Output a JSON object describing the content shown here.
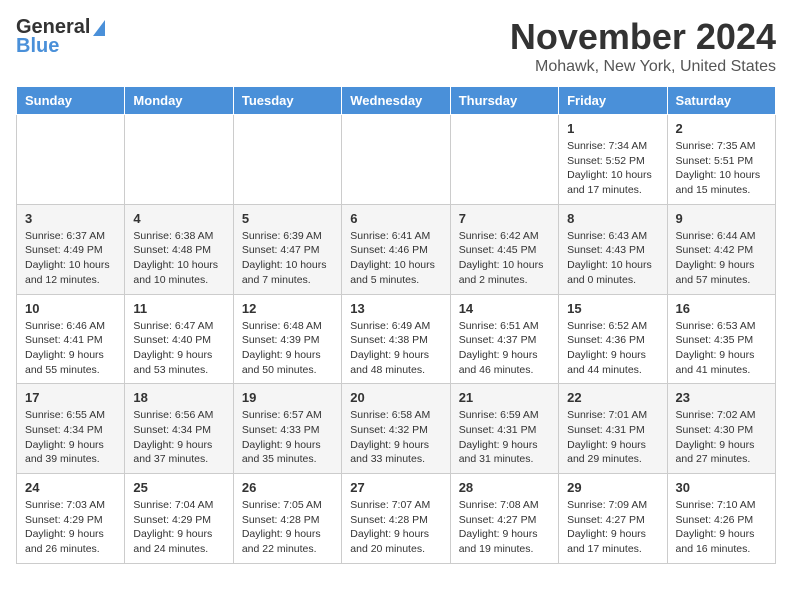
{
  "header": {
    "logo_line1": "General",
    "logo_line2": "Blue",
    "month": "November 2024",
    "location": "Mohawk, New York, United States"
  },
  "weekdays": [
    "Sunday",
    "Monday",
    "Tuesday",
    "Wednesday",
    "Thursday",
    "Friday",
    "Saturday"
  ],
  "weeks": [
    [
      {
        "day": "",
        "info": ""
      },
      {
        "day": "",
        "info": ""
      },
      {
        "day": "",
        "info": ""
      },
      {
        "day": "",
        "info": ""
      },
      {
        "day": "",
        "info": ""
      },
      {
        "day": "1",
        "info": "Sunrise: 7:34 AM\nSunset: 5:52 PM\nDaylight: 10 hours and 17 minutes."
      },
      {
        "day": "2",
        "info": "Sunrise: 7:35 AM\nSunset: 5:51 PM\nDaylight: 10 hours and 15 minutes."
      }
    ],
    [
      {
        "day": "3",
        "info": "Sunrise: 6:37 AM\nSunset: 4:49 PM\nDaylight: 10 hours and 12 minutes."
      },
      {
        "day": "4",
        "info": "Sunrise: 6:38 AM\nSunset: 4:48 PM\nDaylight: 10 hours and 10 minutes."
      },
      {
        "day": "5",
        "info": "Sunrise: 6:39 AM\nSunset: 4:47 PM\nDaylight: 10 hours and 7 minutes."
      },
      {
        "day": "6",
        "info": "Sunrise: 6:41 AM\nSunset: 4:46 PM\nDaylight: 10 hours and 5 minutes."
      },
      {
        "day": "7",
        "info": "Sunrise: 6:42 AM\nSunset: 4:45 PM\nDaylight: 10 hours and 2 minutes."
      },
      {
        "day": "8",
        "info": "Sunrise: 6:43 AM\nSunset: 4:43 PM\nDaylight: 10 hours and 0 minutes."
      },
      {
        "day": "9",
        "info": "Sunrise: 6:44 AM\nSunset: 4:42 PM\nDaylight: 9 hours and 57 minutes."
      }
    ],
    [
      {
        "day": "10",
        "info": "Sunrise: 6:46 AM\nSunset: 4:41 PM\nDaylight: 9 hours and 55 minutes."
      },
      {
        "day": "11",
        "info": "Sunrise: 6:47 AM\nSunset: 4:40 PM\nDaylight: 9 hours and 53 minutes."
      },
      {
        "day": "12",
        "info": "Sunrise: 6:48 AM\nSunset: 4:39 PM\nDaylight: 9 hours and 50 minutes."
      },
      {
        "day": "13",
        "info": "Sunrise: 6:49 AM\nSunset: 4:38 PM\nDaylight: 9 hours and 48 minutes."
      },
      {
        "day": "14",
        "info": "Sunrise: 6:51 AM\nSunset: 4:37 PM\nDaylight: 9 hours and 46 minutes."
      },
      {
        "day": "15",
        "info": "Sunrise: 6:52 AM\nSunset: 4:36 PM\nDaylight: 9 hours and 44 minutes."
      },
      {
        "day": "16",
        "info": "Sunrise: 6:53 AM\nSunset: 4:35 PM\nDaylight: 9 hours and 41 minutes."
      }
    ],
    [
      {
        "day": "17",
        "info": "Sunrise: 6:55 AM\nSunset: 4:34 PM\nDaylight: 9 hours and 39 minutes."
      },
      {
        "day": "18",
        "info": "Sunrise: 6:56 AM\nSunset: 4:34 PM\nDaylight: 9 hours and 37 minutes."
      },
      {
        "day": "19",
        "info": "Sunrise: 6:57 AM\nSunset: 4:33 PM\nDaylight: 9 hours and 35 minutes."
      },
      {
        "day": "20",
        "info": "Sunrise: 6:58 AM\nSunset: 4:32 PM\nDaylight: 9 hours and 33 minutes."
      },
      {
        "day": "21",
        "info": "Sunrise: 6:59 AM\nSunset: 4:31 PM\nDaylight: 9 hours and 31 minutes."
      },
      {
        "day": "22",
        "info": "Sunrise: 7:01 AM\nSunset: 4:31 PM\nDaylight: 9 hours and 29 minutes."
      },
      {
        "day": "23",
        "info": "Sunrise: 7:02 AM\nSunset: 4:30 PM\nDaylight: 9 hours and 27 minutes."
      }
    ],
    [
      {
        "day": "24",
        "info": "Sunrise: 7:03 AM\nSunset: 4:29 PM\nDaylight: 9 hours and 26 minutes."
      },
      {
        "day": "25",
        "info": "Sunrise: 7:04 AM\nSunset: 4:29 PM\nDaylight: 9 hours and 24 minutes."
      },
      {
        "day": "26",
        "info": "Sunrise: 7:05 AM\nSunset: 4:28 PM\nDaylight: 9 hours and 22 minutes."
      },
      {
        "day": "27",
        "info": "Sunrise: 7:07 AM\nSunset: 4:28 PM\nDaylight: 9 hours and 20 minutes."
      },
      {
        "day": "28",
        "info": "Sunrise: 7:08 AM\nSunset: 4:27 PM\nDaylight: 9 hours and 19 minutes."
      },
      {
        "day": "29",
        "info": "Sunrise: 7:09 AM\nSunset: 4:27 PM\nDaylight: 9 hours and 17 minutes."
      },
      {
        "day": "30",
        "info": "Sunrise: 7:10 AM\nSunset: 4:26 PM\nDaylight: 9 hours and 16 minutes."
      }
    ]
  ]
}
